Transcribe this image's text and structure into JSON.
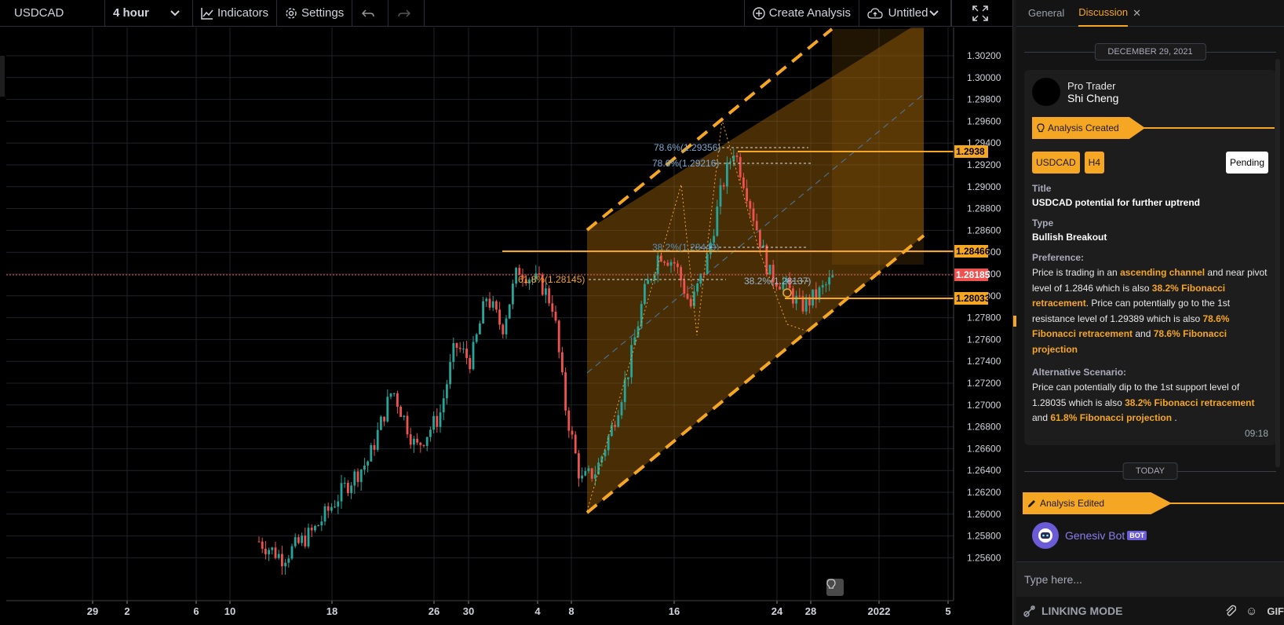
{
  "toolbar": {
    "symbol": "USDCAD",
    "interval": "4 hour",
    "indicators_label": "Indicators",
    "settings_label": "Settings",
    "create_analysis_label": "Create Analysis",
    "save_name": "Untitled"
  },
  "chart": {
    "price_axis": [
      "1.30200",
      "1.30000",
      "1.29800",
      "1.29600",
      "1.29400",
      "1.29200",
      "1.29000",
      "1.28800",
      "1.28600",
      "1.28400",
      "1.28200",
      "1.28000",
      "1.27800",
      "1.27600",
      "1.27400",
      "1.27200",
      "1.27000",
      "1.26800",
      "1.26600",
      "1.26400",
      "1.26200",
      "1.26000",
      "1.25800",
      "1.25600"
    ],
    "time_axis": [
      "29",
      "2",
      "6",
      "10",
      "18",
      "26",
      "30",
      "4",
      "8",
      "16",
      "24",
      "28",
      "2022",
      "5"
    ],
    "price_tags": {
      "level_1": "1.2938",
      "level_2": "1.28466",
      "current": "1.28185",
      "level_3": "1.28033"
    },
    "fib_labels": {
      "f1": "78.6%(1.29356)",
      "f2": "78.6%(1.29216)",
      "f3": "38.2%(1.28449)",
      "f4": "61.8%(1.28145)",
      "f5": "38.2%(1.28137)"
    },
    "colors": {
      "up": "#26a69a",
      "down": "#ef5350",
      "accent": "#f5a623",
      "current": "#ef5350"
    }
  },
  "panel": {
    "tabs": {
      "general": "General",
      "discussion": "Discussion"
    },
    "date_separator": "DECEMBER 29, 2021",
    "author": {
      "role": "Pro Trader",
      "name": "Shi Cheng"
    },
    "banner": "Analysis Created",
    "tags": {
      "symbol": "USDCAD",
      "timeframe": "H4",
      "status": "Pending"
    },
    "title_label": "Title",
    "title_value": "USDCAD potential for further uptrend",
    "type_label": "Type",
    "type_value": "Bullish Breakout",
    "preference_label": "Preference:",
    "preference": {
      "t1": "Price is trading in an ",
      "h1": "ascending channel",
      "t2": " and near pivot level of 1.2846 which is also ",
      "h2": "38.2% Fibonacci retracement",
      "t3": ". Price can potentially go to the 1st resistance level of 1.29389 which is also ",
      "h3": "78.6% Fibonacci retracement",
      "t4": " and ",
      "h4": "78.6% Fibonacci projection"
    },
    "alternative_label": "Alternative Scenario:",
    "alternative": {
      "t1": "Price can potentially dip to the 1st support level of 1.28035 which is also ",
      "h1": "38.2% Fibonacci retracement",
      "t2": " and ",
      "h2": "61.8% Fibonacci projection",
      "t3": " ."
    },
    "card_time": "09:18",
    "today_separator": "TODAY",
    "edited_banner": "Analysis Edited",
    "bot_name": "Genesiv Bot",
    "bot_badge": "BOT",
    "composer_placeholder": "Type here...",
    "linking_mode": "LINKING MODE",
    "gif_label": "GIF"
  }
}
